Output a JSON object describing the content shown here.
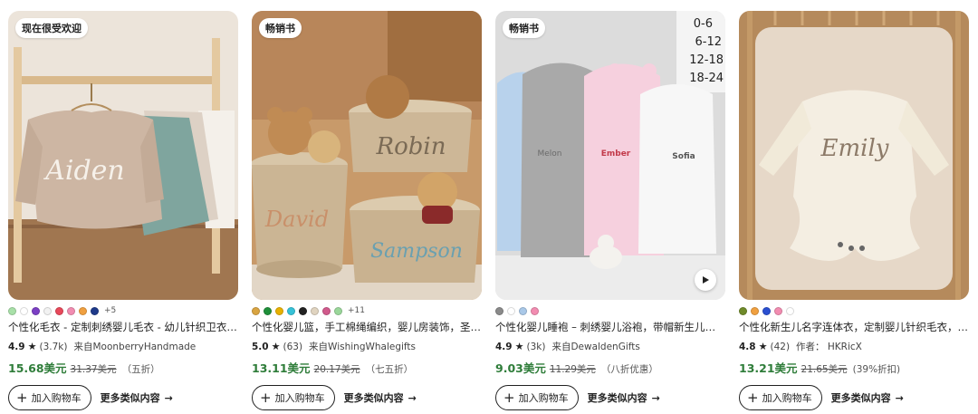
{
  "products": [
    {
      "badge": "现在很受欢迎",
      "swatches": [
        "#a8e0a8",
        "#ffffff",
        "#7b3fc4",
        "#f2f2f2",
        "#e8485a",
        "#f28cb1",
        "#f0a040",
        "#1e3a8a"
      ],
      "more_colors": "+5",
      "title": "个性化毛衣 - 定制刺绣婴儿毛衣 - 幼儿针织卫衣 - ...",
      "rating": "4.9",
      "reviews": "(3.7k)",
      "seller": "来自MoonberryHandmade",
      "price": "15.68美元",
      "original_price": "31.37美元",
      "discount": "（五折）",
      "add_to_cart": "加入购物车",
      "more_like_this": "更多类似内容",
      "image_text": [
        "Aiden"
      ]
    },
    {
      "badge": "畅销书",
      "swatches": [
        "#d9a441",
        "#1f8f3a",
        "#e8b100",
        "#36c2d8",
        "#222222",
        "#e0d4c0",
        "#d15a8c",
        "#9ad79a"
      ],
      "more_colors": "+11",
      "title": "个性化婴儿篮，手工棉绳编织，婴儿房装饰，圣诞...",
      "rating": "5.0",
      "reviews": "(63)",
      "seller": "来自WishingWhalegifts",
      "price": "13.11美元",
      "original_price": "20.17美元",
      "discount": "（七五折）",
      "add_to_cart": "加入购物车",
      "more_like_this": "更多类似内容",
      "image_text": [
        "Robin",
        "David",
        "Sampson"
      ]
    },
    {
      "badge": "畅销书",
      "swatches": [
        "#8a8a8a",
        "#ffffff",
        "#a9c8e8",
        "#f28cb1"
      ],
      "more_colors": "",
      "title": "个性化婴儿睡袍 – 刺绣婴儿浴袍，带帽新生儿及幼...",
      "rating": "4.9",
      "reviews": "(3k)",
      "seller": "来自DewaldenGifts",
      "price": "9.03美元",
      "original_price": "11.29美元",
      "discount": "（八折优惠）",
      "add_to_cart": "加入购物车",
      "more_like_this": "更多类似内容",
      "image_text": [
        "0-6",
        "6-12",
        "12-18",
        "18-24",
        "Melon",
        "Ember",
        "Sofia"
      ]
    },
    {
      "badge": "",
      "swatches": [
        "#6f8a2a",
        "#f0a040",
        "#2a4fd1",
        "#f28cb1",
        "#ffffff"
      ],
      "more_colors": "",
      "title": "个性化新生儿名字连体衣，定制婴儿针织毛衣，婴...",
      "rating": "4.8",
      "reviews": "(42)",
      "seller": "作者： HKRicX",
      "price": "13.21美元",
      "original_price": "21.65美元",
      "discount": "(39%折扣)",
      "add_to_cart": "加入购物车",
      "more_like_this": "更多类似内容",
      "image_text": [
        "Emily"
      ]
    }
  ]
}
